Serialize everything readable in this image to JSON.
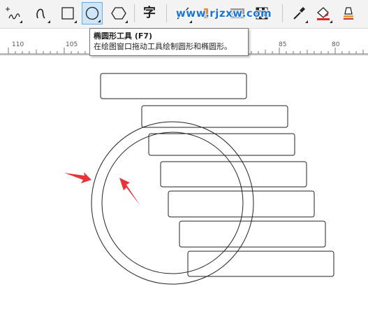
{
  "toolbar": {
    "tools": [
      {
        "name": "freehand-tool",
        "icon": "freehand-icon"
      },
      {
        "name": "artistic-media-tool",
        "icon": "artistic-media-icon"
      },
      {
        "name": "rectangle-tool",
        "icon": "rectangle-icon"
      },
      {
        "name": "ellipse-tool",
        "icon": "ellipse-icon",
        "active": true
      },
      {
        "name": "polygon-tool",
        "icon": "polygon-icon"
      },
      {
        "name": "text-tool",
        "icon": "text-icon",
        "label": "字"
      },
      {
        "name": "connector-tool",
        "icon": "connector-icon"
      },
      {
        "name": "eyedropper-tool",
        "icon": "eyedropper-icon"
      },
      {
        "name": "fill-tool",
        "icon": "fill-icon"
      },
      {
        "name": "smart-fill-tool",
        "icon": "smart-fill-icon"
      }
    ],
    "watermark": "www.rjzxw.com"
  },
  "tooltip": {
    "title": "椭圆形工具 (F7)",
    "description": "在绘图窗口拖动工具绘制圆形和椭圆形。"
  },
  "ruler": {
    "labels": [
      "110",
      "105",
      "85",
      "80"
    ]
  },
  "colors": {
    "active_tool_bg": "#cfe6f8",
    "active_tool_border": "#6aa9dd",
    "arrow": "#e8333a",
    "watermark": "#1b74d6"
  },
  "canvas": {
    "rectangles_count": 7,
    "circles": [
      "outer-circle",
      "inner-circle"
    ],
    "arrows": [
      "pointer-arrow-left",
      "pointer-arrow-inner"
    ]
  }
}
